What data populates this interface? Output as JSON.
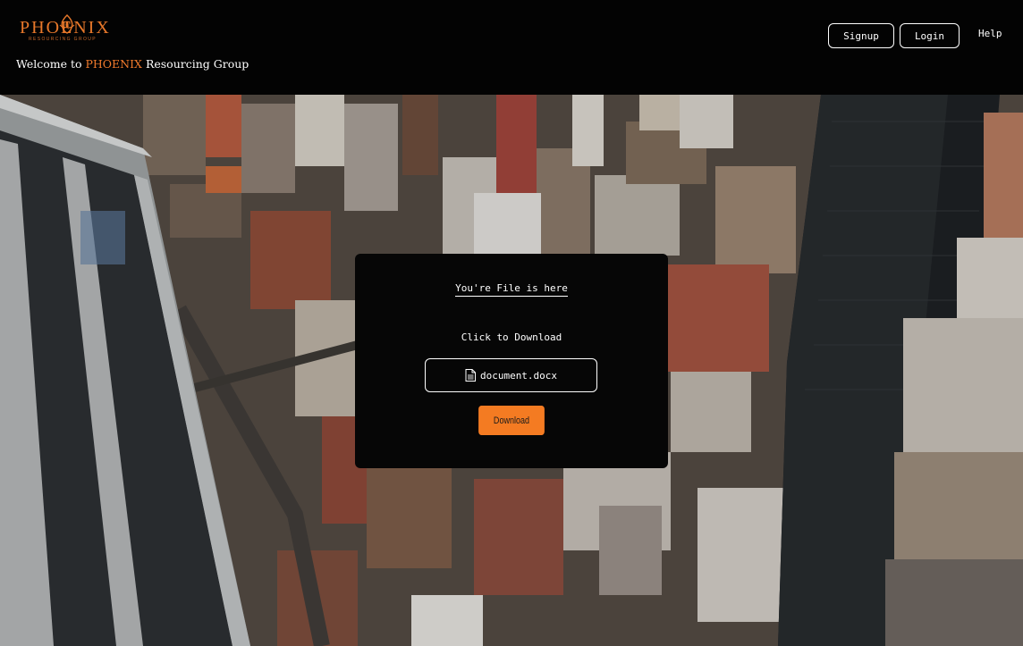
{
  "header": {
    "logo": {
      "wordmark": "PHOENIX",
      "tagline": "RESOURCING GROUP",
      "icon": "phoenix-flame-icon"
    },
    "welcome": {
      "prefix": "Welcome to ",
      "brand": "PHOENIX",
      "suffix": " Resourcing Group"
    },
    "nav": {
      "signup": "Signup",
      "login": "Login",
      "help": "Help"
    }
  },
  "background": {
    "description_icon": "city-aerial-photo"
  },
  "card": {
    "heading": "You're File is here",
    "instruction": "Click to Download",
    "file": {
      "name": "document.docx",
      "icon": "document-icon"
    },
    "download_label": "Download"
  },
  "colors": {
    "accent": "#f47b22",
    "header_bg": "#030303",
    "card_bg": "#060606"
  }
}
